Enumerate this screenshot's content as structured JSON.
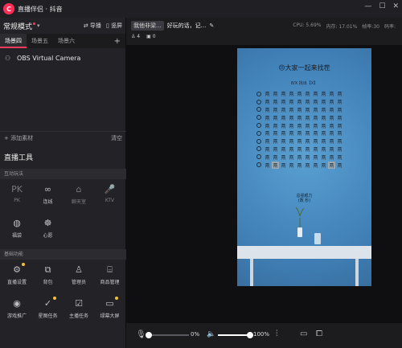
{
  "app": {
    "logo_text": "C",
    "title": "直播伴侣 · 抖音"
  },
  "window_controls": [
    "—",
    "☐",
    "✕"
  ],
  "mode": {
    "label": "常规模式",
    "import_label": "导播",
    "layout_label": "竖屏"
  },
  "scene_tabs": [
    "场景四",
    "场景五",
    "场景六"
  ],
  "sources": [
    {
      "name": "OBS Virtual Camera"
    }
  ],
  "source_footer": {
    "add_label": "添加素材",
    "clear_label": "清空"
  },
  "tools": {
    "title": "直播工具",
    "group1_label": "互动玩法",
    "group1": [
      {
        "label": "PK",
        "icon": "pk-icon",
        "glyph": "PK",
        "dim": true
      },
      {
        "label": "连线",
        "icon": "link-icon",
        "glyph": "∞",
        "dim": false
      },
      {
        "label": "聊天室",
        "icon": "chatroom-icon",
        "glyph": "⌂",
        "dim": true
      },
      {
        "label": "KTV",
        "icon": "mic-icon",
        "glyph": "🎤",
        "dim": true
      },
      {
        "label": "福袋",
        "icon": "lucky-bag-icon",
        "glyph": "◍",
        "dim": false
      },
      {
        "label": "心愿",
        "icon": "wish-icon",
        "glyph": "☸",
        "dim": false
      }
    ],
    "group2_label": "基础功能",
    "group2": [
      {
        "label": "直播设置",
        "icon": "settings-icon",
        "glyph": "⚙",
        "badge": true
      },
      {
        "label": "背包",
        "icon": "backpack-icon",
        "glyph": "⧉",
        "badge": false
      },
      {
        "label": "管理员",
        "icon": "admin-icon",
        "glyph": "♙",
        "badge": false
      },
      {
        "label": "商品管理",
        "icon": "store-icon",
        "glyph": "⌸",
        "badge": false
      },
      {
        "label": "游戏推广",
        "icon": "gamepad-icon",
        "glyph": "◉",
        "badge": false
      },
      {
        "label": "星图任务",
        "icon": "star-task-icon",
        "glyph": "✓",
        "badge": true
      },
      {
        "label": "主播任务",
        "icon": "task-icon",
        "glyph": "☑",
        "badge": false
      },
      {
        "label": "绿幕大屏",
        "icon": "screen-icon",
        "glyph": "▭",
        "badge": true
      }
    ]
  },
  "room": {
    "pill": "我他非梁...",
    "name": "好玩的话，记...",
    "edit_icon": "✎"
  },
  "counters": {
    "viewers": "4",
    "likes": "0"
  },
  "stats": {
    "cpu": "CPU: 5.69%",
    "memory": "内存: 17.01%",
    "fps": "帧率:30",
    "bitrate": "码率:"
  },
  "preview": {
    "title": "😣大家一起来找茬",
    "subtitle": "8/X 找出【X】",
    "grid_rows": 10,
    "grid_cols": 10,
    "grid_char": "鬲",
    "highlight_cells": [
      [
        9,
        1
      ],
      [
        9,
        8
      ]
    ],
    "hint_line1": "总强眼力",
    "hint_line2": "(数 秒)"
  },
  "bottom": {
    "mic_volume_pct": 0,
    "mic_label": "0%",
    "speaker_volume_pct": 100,
    "speaker_label": "100%"
  },
  "colors": {
    "accent": "#ff3b5c",
    "badge": "#f5c232",
    "preview_bg": "#4f8fc4"
  }
}
